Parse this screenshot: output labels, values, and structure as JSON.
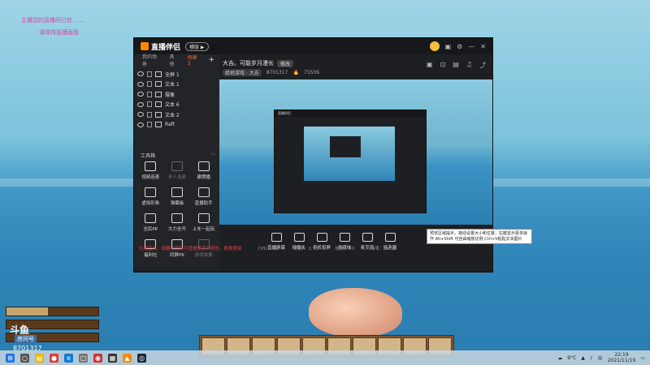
{
  "overlay": {
    "line1": "主播您的直播间已在 ……",
    "line2": "请保持直播画面"
  },
  "app": {
    "logo": "直播伴侣",
    "mode": "横版 ▶",
    "tabs": [
      "我的场景",
      "其他",
      "场景3"
    ],
    "tab_add": "+",
    "sources": [
      "全屏 1",
      "文本 1",
      "摄像",
      "文本 6",
      "文本 2",
      "Raft"
    ],
    "tools_header": "工具箱",
    "tools": [
      "视频连麦",
      "多人连麦",
      "建牌播",
      "虚拟形象",
      "弹幕板",
      "直播助手",
      "全民PK",
      "大力全开",
      "上车一起玩",
      "福利社",
      "同屏PK",
      "游戏录像"
    ],
    "room_title": "大吉。可能岁月漫长",
    "edit_label": "修改",
    "category": "绝地游戏 · 大吉",
    "room_number": "8701317",
    "followers": "75536",
    "bottom_buttons": [
      "直播屏幕",
      "摄像头",
      "手机投屏",
      "多媒体",
      "麦克风",
      "扬声器"
    ],
    "status": [
      "礼物任务，请翻动鼠标可查看更多列表时，数据更新",
      "CPU：4%",
      "内存：2.7G",
      "帧率：60",
      "码率：0kb/s"
    ],
    "tooltip": "预览区域提示，拖动设置大小和位置，右键显示更多操作 Alt+Shift 可自由缩放比例 Ctrl+V粘贴文本图片"
  },
  "game": {
    "brand": "斗鱼",
    "room_label": "房间号",
    "room_id": "8701317",
    "hud_levels": [
      0.45,
      0.0,
      0.0
    ],
    "hotbar_slots": 10
  },
  "taskbar": {
    "weather": "9°C",
    "lang": "中",
    "time": "22:19",
    "date": "2021/11/19"
  },
  "colors": {
    "accent": "#ff6c2c",
    "app_bg": "#1e1f23",
    "sea": "#2f86b8"
  }
}
